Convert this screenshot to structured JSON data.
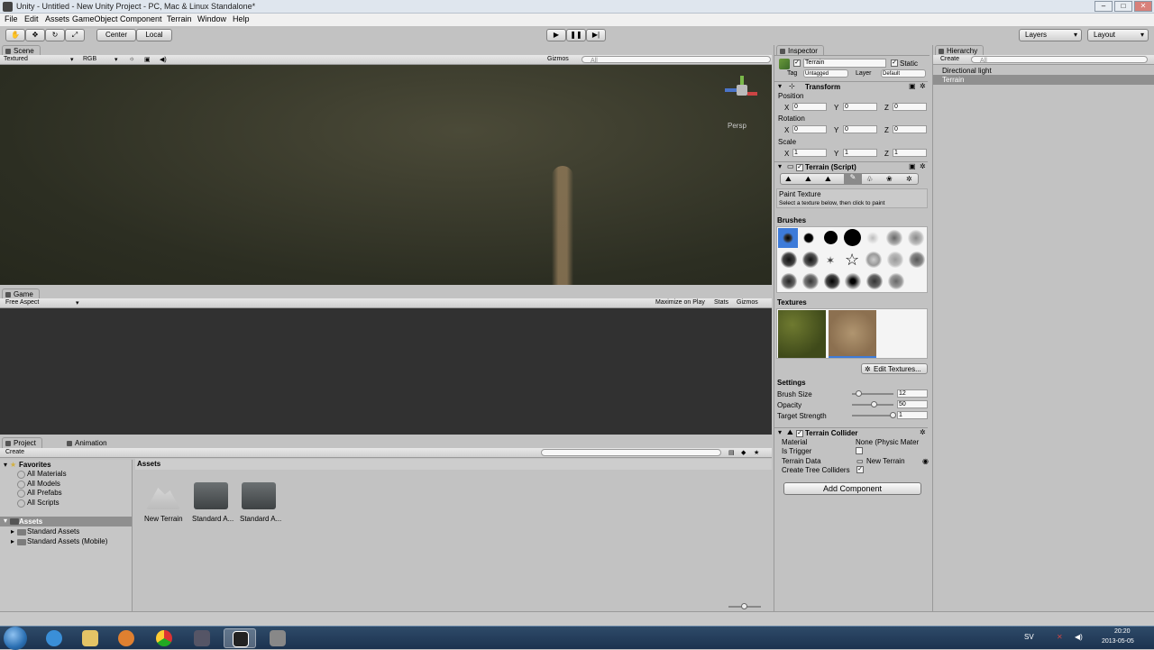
{
  "window": {
    "title": "Unity - Untitled - New Unity Project - PC, Mac & Linux Standalone*",
    "minimize": "–",
    "maximize": "□",
    "close": "✕"
  },
  "menu": [
    "File",
    "Edit",
    "Assets",
    "GameObject",
    "Component",
    "Terrain",
    "Window",
    "Help"
  ],
  "toolbar": {
    "pivot": "Center",
    "space": "Local",
    "layers": "Layers",
    "layout": "Layout"
  },
  "scene": {
    "tab": "Scene",
    "render_mode": "Textured",
    "color_mode": "RGB",
    "gizmos": "Gizmos",
    "search": "All",
    "persp": "Persp"
  },
  "game": {
    "tab": "Game",
    "aspect": "Free Aspect",
    "maximize_on_play": "Maximize on Play",
    "stats": "Stats",
    "gizmos": "Gizmos"
  },
  "inspector": {
    "tab": "Inspector",
    "object_name": "Terrain",
    "static": "Static",
    "tag_label": "Tag",
    "tag_value": "Untagged",
    "layer_label": "Layer",
    "layer_value": "Default",
    "transform": {
      "title": "Transform",
      "position": {
        "label": "Position",
        "x": "0",
        "y": "0",
        "z": "0"
      },
      "rotation": {
        "label": "Rotation",
        "x": "0",
        "y": "0",
        "z": "0"
      },
      "scale": {
        "label": "Scale",
        "x": "1",
        "y": "1",
        "z": "1"
      },
      "x": "X",
      "y": "Y",
      "z": "Z"
    },
    "terrain_script": {
      "title": "Terrain (Script)",
      "mode_title": "Paint Texture",
      "mode_hint": "Select a texture below, then click to paint",
      "brushes_title": "Brushes",
      "textures_title": "Textures",
      "edit_textures": "Edit Textures...",
      "settings_title": "Settings",
      "brush_size": {
        "label": "Brush Size",
        "value": "12",
        "fraction": 0.1
      },
      "opacity": {
        "label": "Opacity",
        "value": "50",
        "fraction": 0.5
      },
      "target_strength": {
        "label": "Target Strength",
        "value": "1",
        "fraction": 1.0
      }
    },
    "terrain_collider": {
      "title": "Terrain Collider",
      "material_label": "Material",
      "material_value": "None (Physic Mater",
      "is_trigger_label": "Is Trigger",
      "is_trigger": false,
      "terrain_data_label": "Terrain Data",
      "terrain_data_value": "New Terrain",
      "create_tree_colliders_label": "Create Tree Colliders",
      "create_tree_colliders": true
    },
    "add_component": "Add Component"
  },
  "hierarchy": {
    "tab": "Hierarchy",
    "create": "Create",
    "search": "All",
    "items": [
      "Directional light",
      "Terrain"
    ]
  },
  "project": {
    "tab": "Project",
    "animation_tab": "Animation",
    "create": "Create",
    "favorites": "Favorites",
    "favorite_items": [
      "All Materials",
      "All Models",
      "All Prefabs",
      "All Scripts"
    ],
    "assets": "Assets",
    "asset_folders": [
      "Standard Assets",
      "Standard Assets (Mobile)"
    ],
    "breadcrumb": "Assets",
    "grid_items": [
      "New Terrain",
      "Standard A...",
      "Standard A..."
    ]
  },
  "taskbar": {
    "lang": "SV",
    "time": "20:20",
    "date": "2013-05-05"
  },
  "colors": {
    "selection": "#3d7bd9",
    "scene_ground": "#34362a",
    "game_bg": "#313131"
  }
}
